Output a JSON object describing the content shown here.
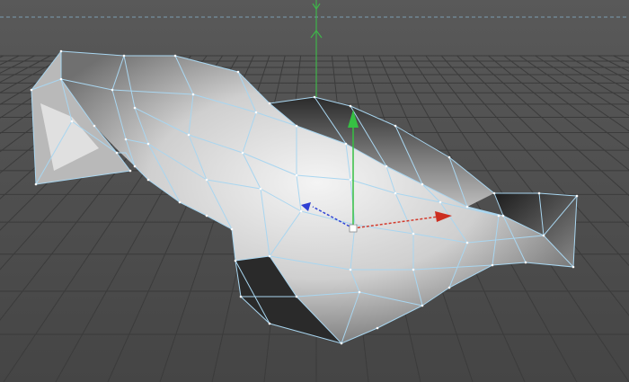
{
  "viewport": {
    "background_color": "#4d4d4d",
    "grid_color": "#3b3b3b",
    "world_axis_y_color": "#2fbf3a",
    "horizon_line_color": "#7aa0b8"
  },
  "mesh": {
    "shading": "gradient",
    "wireframe_color": "#a9d6f0",
    "vertex_color": "#ffffff"
  },
  "gizmo": {
    "x_axis_color": "#d62b1f",
    "y_axis_color": "#2fbf3a",
    "z_axis_color": "#2a3fd1"
  }
}
